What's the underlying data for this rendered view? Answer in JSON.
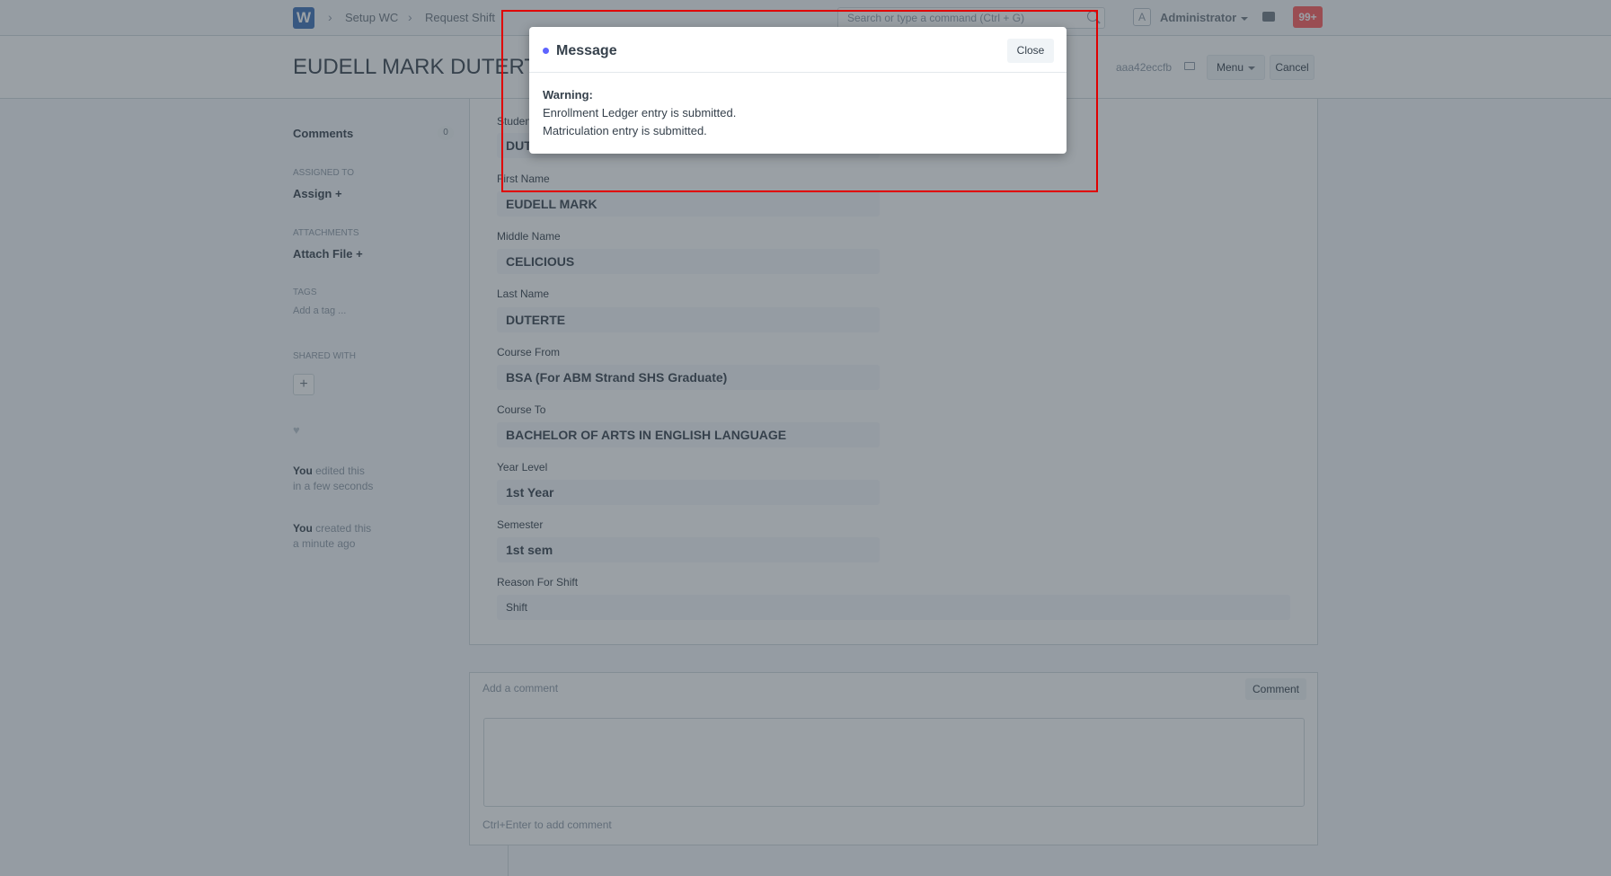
{
  "navbar": {
    "logo": "W",
    "breadcrumbs": [
      "Setup WC",
      "Request Shift"
    ],
    "search_placeholder": "Search or type a command (Ctrl + G)",
    "avatar": "A",
    "user": "Administrator",
    "notifications": "99+"
  },
  "header": {
    "title": "EUDELL MARK DUTERTE",
    "docname": "aaa42eccfb",
    "menu_label": "Menu",
    "cancel_label": "Cancel"
  },
  "sidebar": {
    "comments_label": "Comments",
    "comments_count": "0",
    "assigned_to_label": "Assigned To",
    "assign_link": "Assign +",
    "attachments_label": "Attachments",
    "attach_link": "Attach File +",
    "tags_label": "Tags",
    "add_tag": "Add a tag ...",
    "shared_with_label": "Shared With",
    "timeline": [
      {
        "who": "You",
        "action": "edited this",
        "when": "in a few seconds"
      },
      {
        "who": "You",
        "action": "created this",
        "when": "a minute ago"
      }
    ]
  },
  "form": {
    "fields": [
      {
        "label": "Student",
        "value": "DUTERTE"
      },
      {
        "label": "First Name",
        "value": "EUDELL MARK"
      },
      {
        "label": "Middle Name",
        "value": "CELICIOUS"
      },
      {
        "label": "Last Name",
        "value": "DUTERTE"
      },
      {
        "label": "Course From",
        "value": "BSA (For ABM Strand SHS Graduate)"
      },
      {
        "label": "Course To",
        "value": "BACHELOR OF ARTS IN ENGLISH LANGUAGE"
      },
      {
        "label": "Year Level",
        "value": "1st Year"
      },
      {
        "label": "Semester",
        "value": "1st sem"
      },
      {
        "label": "Reason For Shift",
        "value": "Shift"
      }
    ]
  },
  "comments": {
    "placeholder": "Add a comment",
    "button": "Comment",
    "hint": "Ctrl+Enter to add comment"
  },
  "modal": {
    "title": "Message",
    "close_label": "Close",
    "warning_label": "Warning:",
    "lines": [
      "Enrollment Ledger entry is submitted.",
      "Matriculation entry is submitted."
    ]
  },
  "colors": {
    "accent": "#5e64ff",
    "danger": "#ff5858",
    "highlight": "#e00000"
  }
}
